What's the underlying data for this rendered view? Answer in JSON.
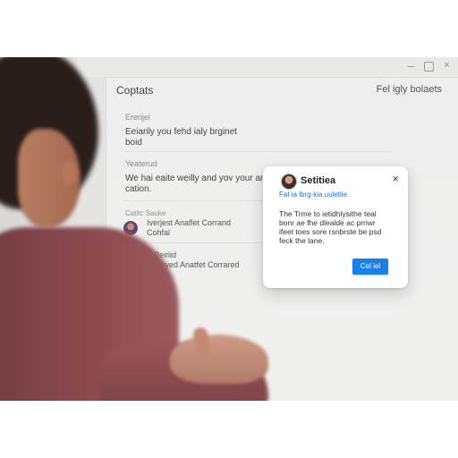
{
  "window": {
    "title": "Coptats",
    "action": "Fel igly bolaets",
    "window_controls": [
      "minimize-icon",
      "restore-icon",
      "close-icon"
    ]
  },
  "sections": [
    {
      "label": "Ererijel",
      "text": "Eeiarily you fehd ialy brginet\nboid"
    },
    {
      "label": "Yeaterud",
      "text": "We hai eaite weilly and yov your and\ncation."
    }
  ],
  "contacts": {
    "label": "Catitc Sauke",
    "items": [
      {
        "line1": "Iverjest Anaflet Corrand",
        "line2": "Cohfal"
      },
      {
        "line1": "Peiriid",
        "line2": "Jaryed Anatfet Corrared"
      }
    ]
  },
  "dialog": {
    "title": "Setitiea",
    "link": "Fat ia lbrg-kia uuletlie",
    "body": "The Trme to ietidhlysithe teal bonr ae fhe dlealde ac prriwr ifeet toes sore rsnbrste be psd feck the lane.",
    "button": "Cel iel",
    "accent_color": "#1a7fe8"
  }
}
